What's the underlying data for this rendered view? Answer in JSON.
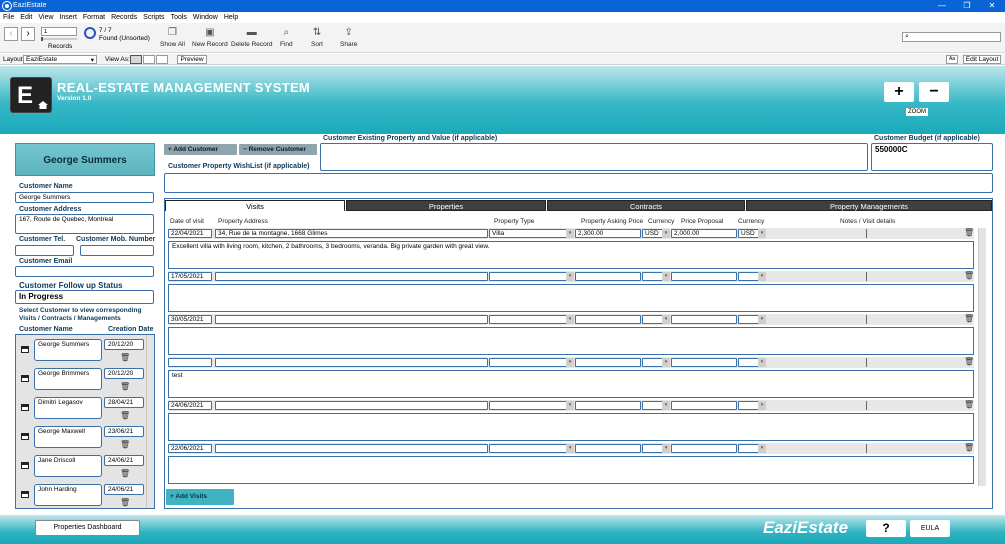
{
  "window": {
    "title": "EaziEstate",
    "controls": [
      "—",
      "❐",
      "✕"
    ]
  },
  "menu": [
    "File",
    "Edit",
    "View",
    "Insert",
    "Format",
    "Records",
    "Scripts",
    "Tools",
    "Window",
    "Help"
  ],
  "toolbar": {
    "record_value": "1",
    "record_total": "7 / 7",
    "found_label": "Found (Unsorted)",
    "records_label": "Records",
    "show_all": "Show All",
    "new_record": "New Record",
    "delete_record": "Delete Record",
    "find": "Find",
    "sort": "Sort",
    "share": "Share"
  },
  "layoutbar": {
    "layout_label": "Layout:",
    "layout_value": "EaziEstate",
    "view_as_label": "View As:",
    "preview": "Preview",
    "aa": "Aa",
    "edit_layout": "Edit Layout"
  },
  "header": {
    "logo_letter": "E",
    "title": "REAL-ESTATE MANAGEMENT SYSTEM",
    "version": "Version 1.0",
    "zoom_in": "+",
    "zoom_out": "−",
    "zoom_label": "ZOOM"
  },
  "customer": {
    "display_name": "George Summers",
    "name_label": "Customer Name",
    "name_value": "George Summers",
    "address_label": "Customer Address",
    "address_value": "167, Route de Quebec, Montreal",
    "tel_label": "Customer Tel.",
    "tel_value": "",
    "mob_label": "Customer Mob. Number",
    "mob_value": "",
    "email_label": "Customer Email",
    "email_value": "",
    "status_label": "Customer Follow up Status",
    "status_value": "In Progress",
    "select_hint": "Select Customer to view corresponding Visits / Contracts / Managements",
    "list_name_header": "Customer Name",
    "list_date_header": "Creation Date"
  },
  "customer_list": [
    {
      "name": "George Summers",
      "date": "20/12/20"
    },
    {
      "name": "George Brimmers",
      "date": "20/12/20"
    },
    {
      "name": "Dimitri Legasov",
      "date": "28/04/21"
    },
    {
      "name": "George Maxwell",
      "date": "23/06/21"
    },
    {
      "name": "Jane Driscoll",
      "date": "24/06/21"
    },
    {
      "name": "John Harding",
      "date": "24/06/21"
    }
  ],
  "middle": {
    "add_customer": "+ Add Customer",
    "remove_customer": "− Remove Customer",
    "existing_property_label": "Customer Existing Property and Value (if applicable)",
    "existing_property_value": "",
    "wishlist_label": "Customer Property WishList (if applicable)",
    "wishlist_value": "",
    "budget_label": "Customer Budget (if applicable)",
    "budget_value": "550000C"
  },
  "tabs": [
    "Visits",
    "Properties",
    "Contracts",
    "Property Managements"
  ],
  "visit_columns": [
    "Date of visit",
    "Property Address",
    "Property Type",
    "Property Asking Price",
    "Currency",
    "Price Proposal",
    "Currency",
    "Notes / Visit details"
  ],
  "visits": [
    {
      "date": "22/04/2021",
      "address": "34, Rue de la montagne, 1668 Glimes",
      "type": "Villa",
      "asking": "2,300.00",
      "cur1": "USD",
      "proposal": "2,000.00",
      "cur2": "USD",
      "notes": "Excellent villa with living room, kitchen, 2 bathrooms, 3 bedrooms, veranda.  Big private garden with great view."
    },
    {
      "date": "17/05/2021",
      "address": "",
      "type": "",
      "asking": "",
      "cur1": "",
      "proposal": "",
      "cur2": "",
      "notes": ""
    },
    {
      "date": "30/05/2021",
      "address": "",
      "type": "",
      "asking": "",
      "cur1": "",
      "proposal": "",
      "cur2": "",
      "notes": ""
    },
    {
      "date": "",
      "address": "",
      "type": "",
      "asking": "",
      "cur1": "",
      "proposal": "",
      "cur2": "",
      "notes": "test"
    },
    {
      "date": "24/06/2021",
      "address": "",
      "type": "",
      "asking": "",
      "cur1": "",
      "proposal": "",
      "cur2": "",
      "notes": ""
    },
    {
      "date": "22/06/2021",
      "address": "",
      "type": "",
      "asking": "",
      "cur1": "",
      "proposal": "",
      "cur2": "",
      "notes": ""
    }
  ],
  "add_visits": "+ Add Visits",
  "footer": {
    "dashboard": "Properties Dashboard",
    "brand": "EaziEstate",
    "help": "?",
    "eula": "EULA"
  },
  "colors": {
    "teal": "#36b8c6",
    "navy_border": "#3b6fa8",
    "tab_dark": "#3f3f3f",
    "titlebar": "#0a64d6"
  }
}
